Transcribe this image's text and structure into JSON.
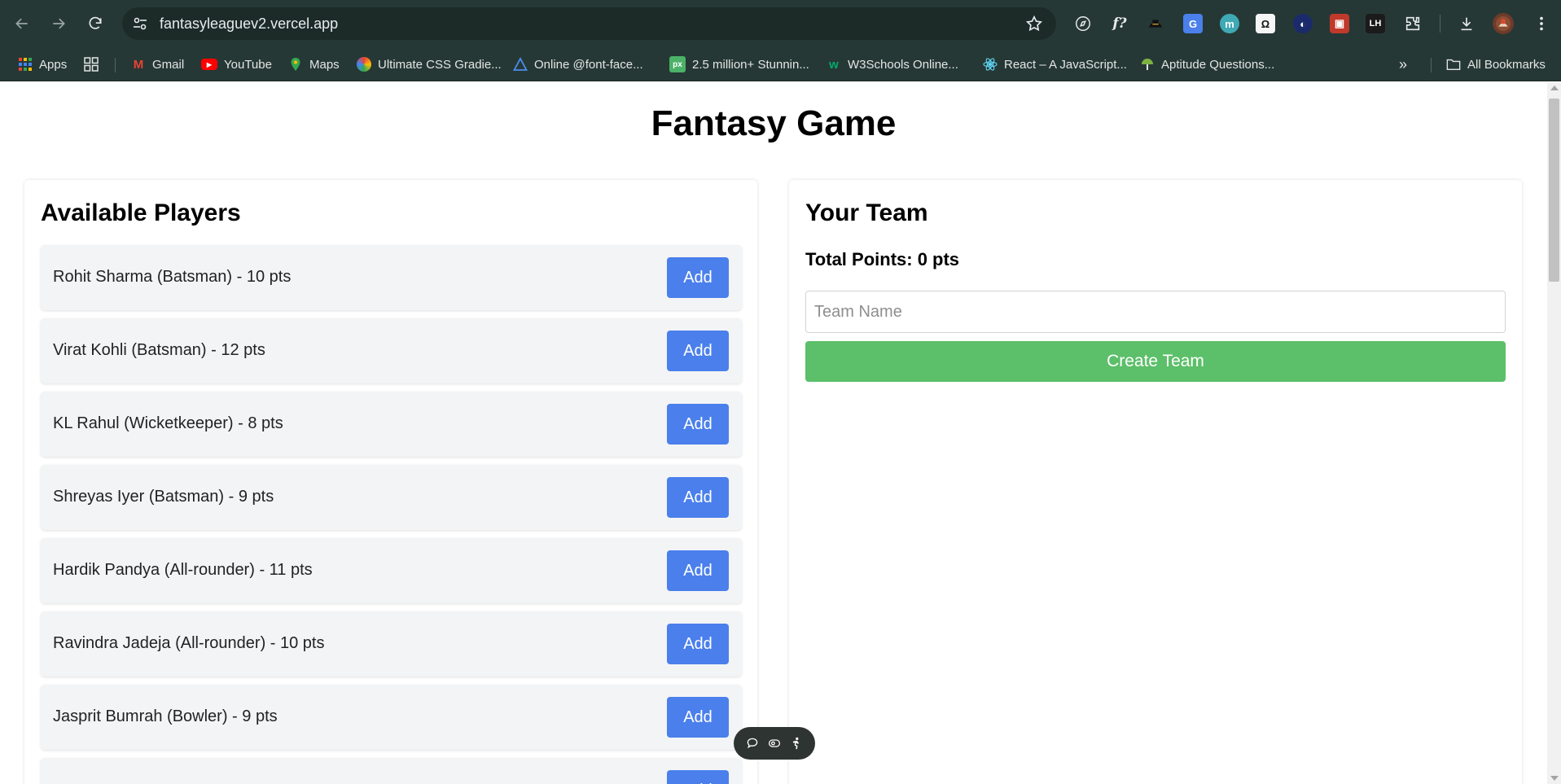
{
  "browser": {
    "url": "fantasyleaguev2.vercel.app",
    "bookmarks": [
      {
        "label": "Apps",
        "icon": "apps-grid-icon"
      },
      {
        "label": "Gmail",
        "icon": "gmail-icon"
      },
      {
        "label": "YouTube",
        "icon": "youtube-icon"
      },
      {
        "label": "Maps",
        "icon": "maps-icon"
      },
      {
        "label": "Ultimate CSS Gradie...",
        "icon": "css-gradient-icon"
      },
      {
        "label": "Online @font-face...",
        "icon": "font-face-icon"
      },
      {
        "label": "2.5 million+ Stunnin...",
        "icon": "pixabay-icon"
      },
      {
        "label": "W3Schools Online...",
        "icon": "w3schools-icon"
      },
      {
        "label": "React – A JavaScript...",
        "icon": "react-icon"
      },
      {
        "label": "Aptitude Questions...",
        "icon": "aptitude-icon"
      }
    ],
    "all_bookmarks_label": "All Bookmarks",
    "colors": {
      "chrome_bg": "#263835",
      "omnibox_bg": "#1c2b28"
    }
  },
  "page": {
    "title": "Fantasy Game",
    "available": {
      "heading": "Available Players",
      "add_label": "Add",
      "players": [
        "Rohit Sharma (Batsman) - 10 pts",
        "Virat Kohli (Batsman) - 12 pts",
        "KL Rahul (Wicketkeeper) - 8 pts",
        "Shreyas Iyer (Batsman) - 9 pts",
        "Hardik Pandya (All-rounder) - 11 pts",
        "Ravindra Jadeja (All-rounder) - 10 pts",
        "Jasprit Bumrah (Bowler) - 9 pts",
        ""
      ]
    },
    "team": {
      "heading": "Your Team",
      "total_points": "Total Points: 0 pts",
      "name_placeholder": "Team Name",
      "create_label": "Create Team"
    },
    "colors": {
      "add_button": "#4a7fec",
      "create_button": "#5cbf69",
      "row_bg": "#f3f4f6"
    }
  }
}
